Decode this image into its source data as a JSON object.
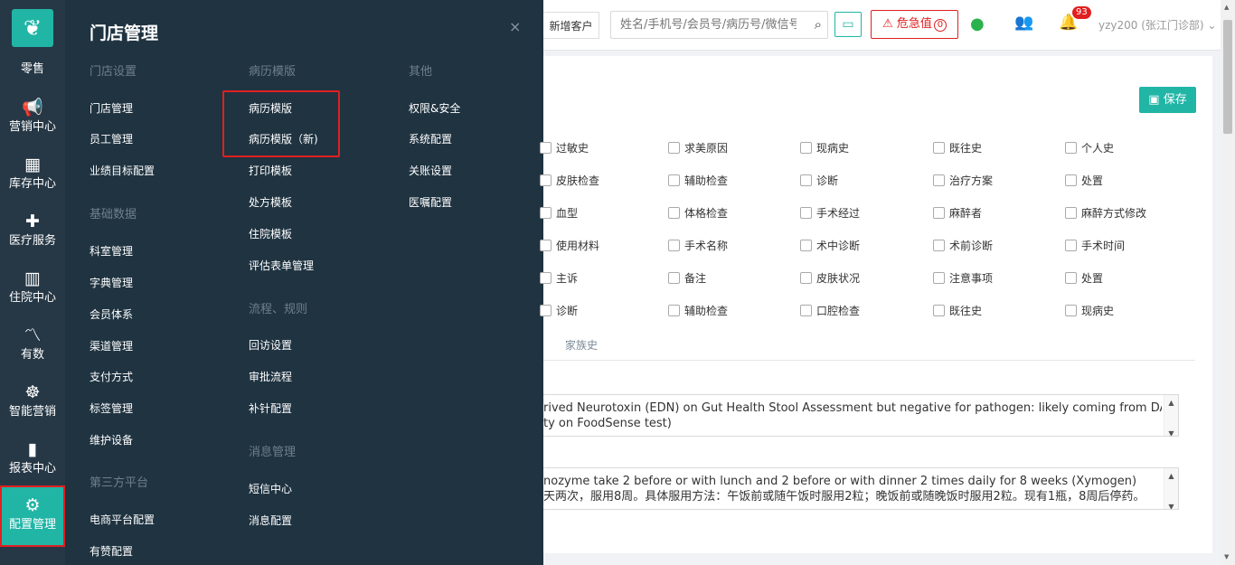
{
  "sidebar": {
    "items": [
      {
        "icon": "▤",
        "label": "零售"
      },
      {
        "icon": "📢",
        "label": "营销中心"
      },
      {
        "icon": "▦",
        "label": "库存中心"
      },
      {
        "icon": "✚",
        "label": "医疗服务"
      },
      {
        "icon": "▥",
        "label": "住院中心"
      },
      {
        "icon": "〽",
        "label": "有数"
      },
      {
        "icon": "☸",
        "label": "智能营销"
      },
      {
        "icon": "▮",
        "label": "报表中心"
      },
      {
        "icon": "⚙",
        "label": "配置管理"
      }
    ]
  },
  "flyout": {
    "title": "门店管理",
    "close": "×",
    "col1": {
      "sections": [
        {
          "title": "门店设置",
          "items": [
            "门店管理",
            "员工管理",
            "业绩目标配置"
          ]
        },
        {
          "title": "基础数据",
          "items": [
            "科室管理",
            "字典管理",
            "会员体系",
            "渠道管理",
            "支付方式",
            "标签管理",
            "维护设备"
          ]
        },
        {
          "title": "第三方平台",
          "items": [
            "电商平台配置",
            "有赞配置"
          ]
        }
      ]
    },
    "col2": {
      "sections": [
        {
          "title": "病历模版",
          "items": [
            "病历模版",
            "病历模版（新)",
            "打印模板",
            "处方模板",
            "住院模板",
            "评估表单管理"
          ]
        },
        {
          "title": "流程、规则",
          "items": [
            "回访设置",
            "审批流程",
            "补针配置"
          ]
        },
        {
          "title": "消息管理",
          "items": [
            "短信中心",
            "消息配置"
          ]
        }
      ]
    },
    "col3": {
      "sections": [
        {
          "title": "其他",
          "items": [
            "权限&安全",
            "系统配置",
            "关账设置",
            "医嘱配置"
          ]
        }
      ]
    }
  },
  "topbar": {
    "add_customer": "新增客户",
    "search_placeholder": "姓名/手机号/会员号/病历号/微信号",
    "critical_label": "危急值",
    "critical_count": "0",
    "notification_count": "93",
    "user": "yzy200 (张江门诊部)"
  },
  "panel": {
    "save_label": "保存",
    "checkbox_rows": [
      [
        "过敏史",
        "求美原因",
        "现病史",
        "既往史",
        "个人史"
      ],
      [
        "皮肤检查",
        "辅助检查",
        "诊断",
        "治疗方案",
        "处置"
      ],
      [
        "血型",
        "体格检查",
        "手术经过",
        "麻醉者",
        "麻醉方式修改"
      ],
      [
        "使用材料",
        "手术名称",
        "术中诊断",
        "术前诊断",
        "手术时间"
      ],
      [
        "主诉",
        "备注",
        "皮肤状况",
        "注意事项",
        "处置"
      ],
      [
        "诊断",
        "辅助检查",
        "口腔检查",
        "既往史",
        "现病史"
      ]
    ],
    "tab_family": "家族史",
    "textarea1_lines": [
      "rived Neurotoxin (EDN) on Gut Health Stool Assessment but negative for pathogen: likely coming from DAIRY",
      "ty on FoodSense test)"
    ],
    "textarea2_lines": [
      "nozyme take 2 before or with lunch and 2 before or with dinner 2 times daily for 8 weeks (Xymogen)",
      "天两次，服用8周。具体服用方法：午饭前或随午饭时服用2粒；晚饭前或随晚饭时服用2粒。现有1瓶，8周后停药。"
    ]
  },
  "colors": {
    "accent": "#21b5a6",
    "sidebar_bg": "#263846",
    "flyout_bg": "#1f3341",
    "alert": "#e02020"
  }
}
